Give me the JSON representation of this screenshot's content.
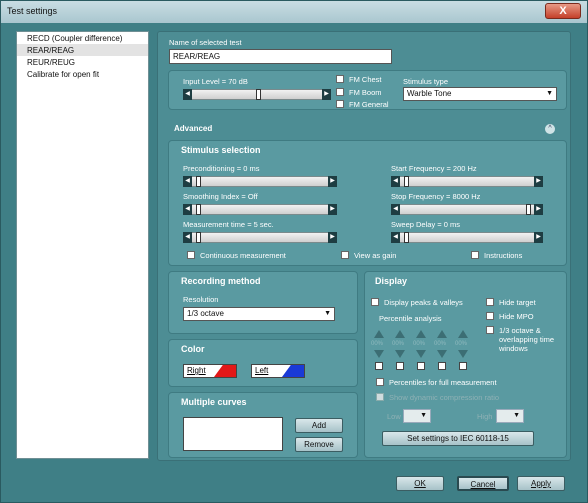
{
  "window": {
    "title": "Test settings",
    "close_glyph": "X"
  },
  "test_list": [
    "RECD (Coupler difference)",
    "REAR/REAG",
    "REUR/REUG",
    "Calibrate for open fit"
  ],
  "selected_index": 1,
  "name": {
    "label": "Name of selected test",
    "value": "REAR/REAG"
  },
  "input_level": {
    "label": "Input Level = 70 dB",
    "level_fraction": 0.5
  },
  "fm": {
    "chest": "FM Chest",
    "boom": "FM Boom",
    "general": "FM General"
  },
  "stimulus_type": {
    "label": "Stimulus type",
    "value": "Warble Tone"
  },
  "advanced": {
    "label": "Advanced",
    "collapse_glyph": "^"
  },
  "stimulus_selection": {
    "title": "Stimulus selection",
    "preconditioning": {
      "label": "Preconditioning = 0 ms",
      "fraction": 0.0
    },
    "smoothing": {
      "label": "Smoothing Index = Off",
      "fraction": 0.0
    },
    "measurement_time": {
      "label": "Measurement time = 5 sec.",
      "fraction": 0.0
    },
    "start_freq": {
      "label": "Start Frequency = 200 Hz",
      "fraction": 0.0
    },
    "stop_freq": {
      "label": "Stop Frequency = 8000 Hz",
      "fraction": 1.0
    },
    "sweep_delay": {
      "label": "Sweep Delay = 0 ms",
      "fraction": 0.0
    },
    "continuous": "Continuous measurement",
    "view_gain": "View as gain",
    "instructions": "Instructions"
  },
  "recording": {
    "title": "Recording method",
    "resolution_label": "Resolution",
    "resolution_value": "1/3 octave"
  },
  "color": {
    "title": "Color",
    "right": "Right",
    "left": "Left",
    "right_color": "#e21818",
    "left_color": "#1a3ad6"
  },
  "multiple_curves": {
    "title": "Multiple curves",
    "add": "Add",
    "remove": "Remove"
  },
  "display": {
    "title": "Display",
    "peaks": "Display peaks & valleys",
    "hide_target": "Hide target",
    "hide_mpo": "Hide MPO",
    "octave": "1/3 octave & overlapping time windows",
    "percentile": "Percentile analysis",
    "pct_values": [
      "00%",
      "00%",
      "00%",
      "00%",
      "00%"
    ],
    "full": "Percentiles for full measurement",
    "dynamic": "Show dynamic compression ratio",
    "low": "Low",
    "high": "High",
    "iec": "Set settings to IEC 60118-15"
  },
  "buttons": {
    "ok": "OK",
    "cancel": "Cancel",
    "apply": "Apply"
  }
}
